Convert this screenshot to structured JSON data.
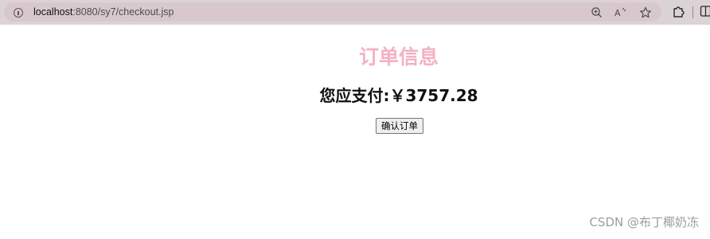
{
  "browser": {
    "url_host": "localhost",
    "url_path": ":8080/sy7/checkout.jsp",
    "icons": [
      "site-info-icon",
      "zoom-icon",
      "read-aloud-icon",
      "favorite-star-icon",
      "extensions-icon",
      "split-screen-icon"
    ]
  },
  "page": {
    "title": "订单信息",
    "pay_label": "您应支付:",
    "currency": "￥",
    "amount": "3757.28",
    "confirm_button": "确认订单"
  },
  "watermark": "CSDN @布丁椰奶冻",
  "colors": {
    "title": "#f4b2c2",
    "toolbar": "#dcd3d7",
    "address_field": "#d8c8ce"
  }
}
